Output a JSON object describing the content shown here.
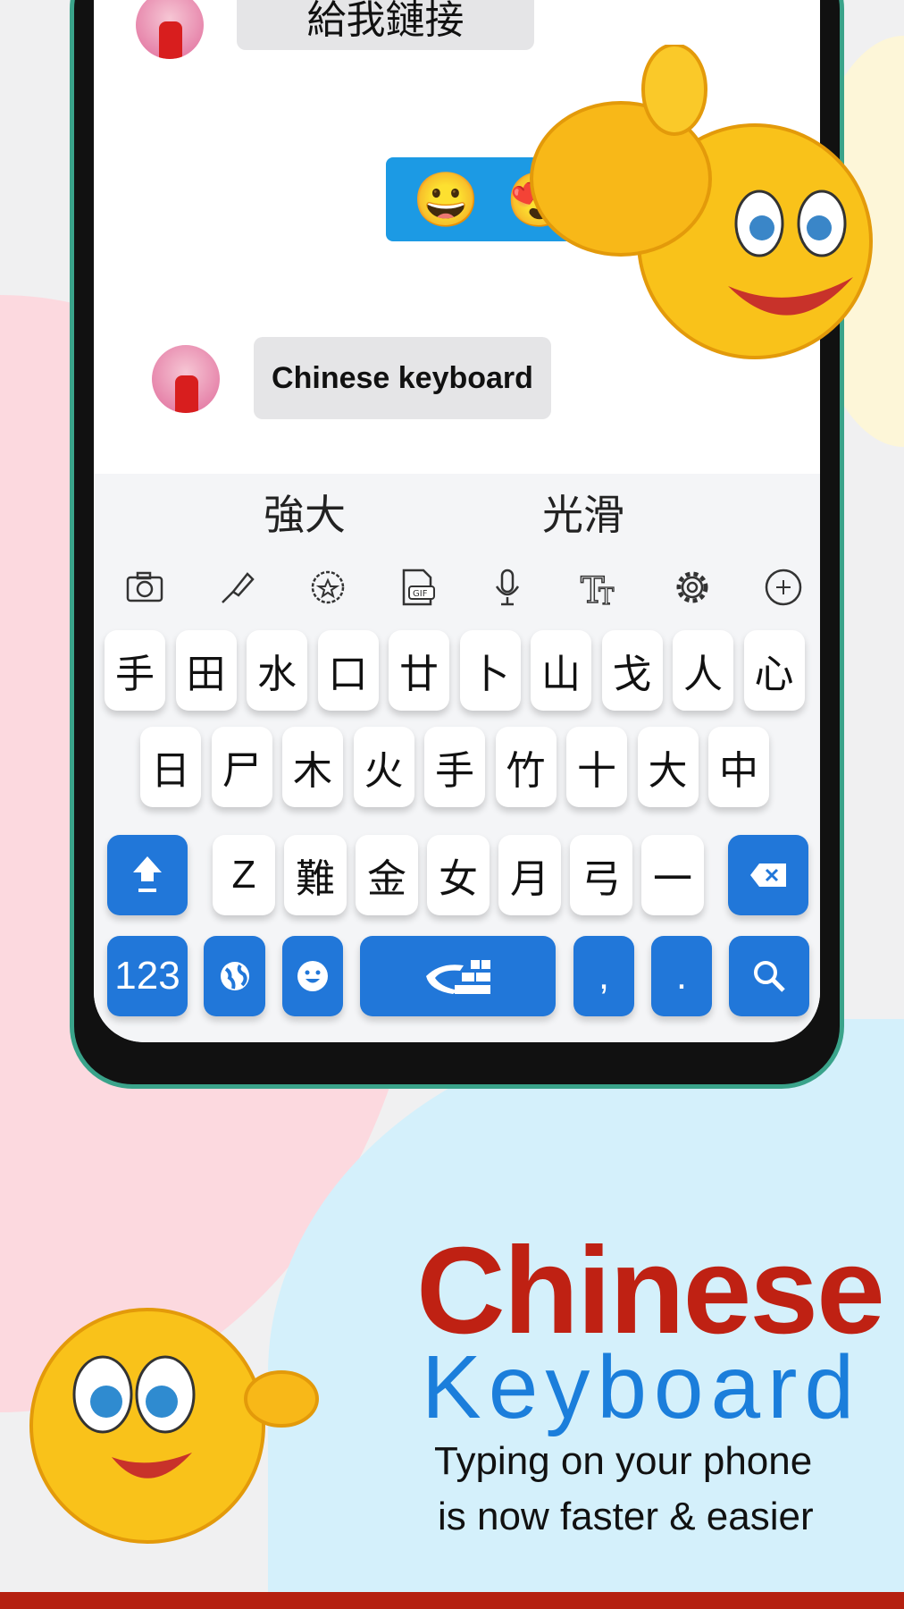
{
  "chat": {
    "messages": [
      {
        "side": "left",
        "text": "給我鏈接"
      },
      {
        "side": "right",
        "emojis": [
          "😀",
          "😍"
        ]
      },
      {
        "side": "left",
        "text": "Chinese keyboard"
      }
    ]
  },
  "suggestions": [
    "強大",
    "光滑"
  ],
  "toolbar": [
    "camera-icon",
    "brush-icon",
    "sticker-icon",
    "gif-icon",
    "microphone-icon",
    "font-icon",
    "settings-icon",
    "add-icon"
  ],
  "keyboard": {
    "row1": [
      "手",
      "田",
      "水",
      "口",
      "廿",
      "卜",
      "山",
      "戈",
      "人",
      "心"
    ],
    "row2": [
      "日",
      "尸",
      "木",
      "火",
      "手",
      "竹",
      "十",
      "大",
      "中"
    ],
    "row3": [
      "Z",
      "難",
      "金",
      "女",
      "月",
      "弓",
      "一"
    ],
    "numbers_label": "123",
    "comma": ",",
    "period": "."
  },
  "promo": {
    "title_line1": "Chinese",
    "title_line2": "Keyboard",
    "tagline1": "Typing on your phone",
    "tagline2": "is now faster & easier"
  },
  "colors": {
    "accent_blue": "#2177d9",
    "title_red": "#bf2113",
    "title_blue": "#1b7edb",
    "bubble_blue": "#1c9ae4"
  }
}
